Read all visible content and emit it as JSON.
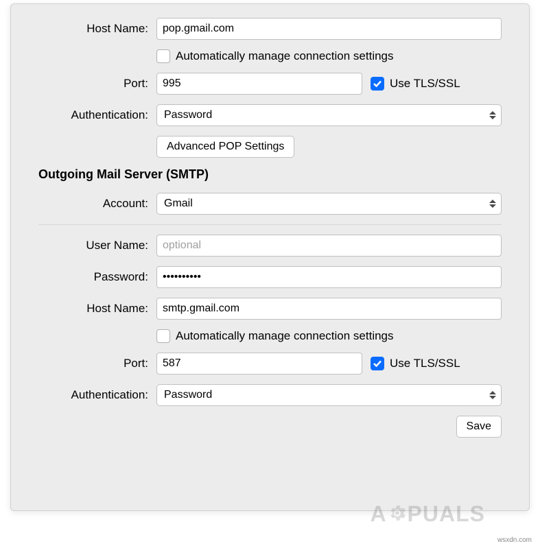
{
  "incoming": {
    "host_name_label": "Host Name:",
    "host_name_value": "pop.gmail.com",
    "auto_manage_label": "Automatically manage connection settings",
    "auto_manage_checked": false,
    "port_label": "Port:",
    "port_value": "995",
    "tls_label": "Use TLS/SSL",
    "tls_checked": true,
    "auth_label": "Authentication:",
    "auth_value": "Password",
    "advanced_button": "Advanced POP Settings"
  },
  "outgoing": {
    "section_title": "Outgoing Mail Server (SMTP)",
    "account_label": "Account:",
    "account_value": "Gmail",
    "user_name_label": "User Name:",
    "user_name_value": "",
    "user_name_placeholder": "optional",
    "password_label": "Password:",
    "password_value": "••••••••••",
    "host_name_label": "Host Name:",
    "host_name_value": "smtp.gmail.com",
    "auto_manage_label": "Automatically manage connection settings",
    "auto_manage_checked": false,
    "port_label": "Port:",
    "port_value": "587",
    "tls_label": "Use TLS/SSL",
    "tls_checked": true,
    "auth_label": "Authentication:",
    "auth_value": "Password"
  },
  "actions": {
    "save_label": "Save"
  },
  "watermark": {
    "text_a": "A",
    "text_puals": "PUALS"
  },
  "source": "wsxdn.com"
}
